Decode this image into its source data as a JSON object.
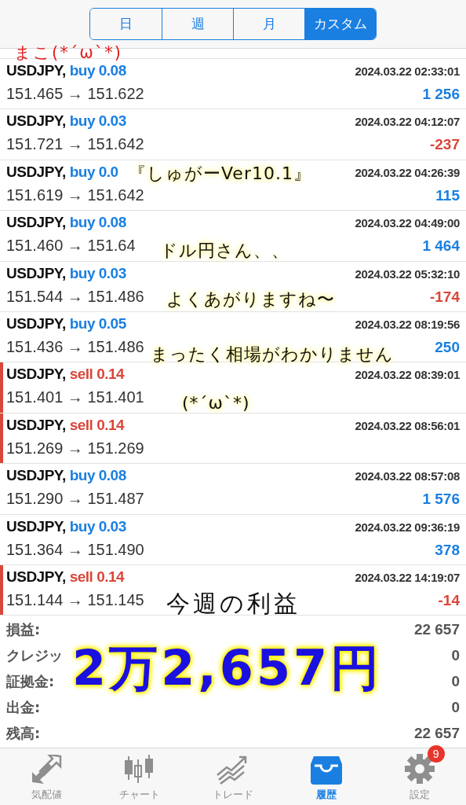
{
  "tabs": [
    {
      "label": "日",
      "selected": false
    },
    {
      "label": "週",
      "selected": false
    },
    {
      "label": "月",
      "selected": false
    },
    {
      "label": "カスタム",
      "selected": true
    }
  ],
  "trades": [
    {
      "symbol": "USDJPY,",
      "order": "buy 0.08",
      "kind": "buy",
      "prices": "151.465 → 151.622",
      "time": "2024.03.22 02:33:01",
      "profit": "1 256",
      "loss": false
    },
    {
      "symbol": "USDJPY,",
      "order": "buy 0.03",
      "kind": "buy",
      "prices": "151.721 → 151.642",
      "time": "2024.03.22 04:12:07",
      "profit": "-237",
      "loss": true
    },
    {
      "symbol": "USDJPY,",
      "order": "buy 0.0",
      "kind": "buy",
      "prices": "151.619 → 151.642",
      "time": "2024.03.22 04:26:39",
      "profit": "115",
      "loss": false
    },
    {
      "symbol": "USDJPY,",
      "order": "buy 0.08",
      "kind": "buy",
      "prices": "151.460 → 151.64",
      "time": "2024.03.22 04:49:00",
      "profit": "1 464",
      "loss": false
    },
    {
      "symbol": "USDJPY,",
      "order": "buy 0.03",
      "kind": "buy",
      "prices": "151.544 → 151.486",
      "time": "2024.03.22 05:32:10",
      "profit": "-174",
      "loss": true
    },
    {
      "symbol": "USDJPY,",
      "order": "buy 0.05",
      "kind": "buy",
      "prices": "151.436 → 151.486",
      "time": "2024.03.22 08:19:56",
      "profit": "250",
      "loss": false
    },
    {
      "symbol": "USDJPY,",
      "order": "sell 0.14",
      "kind": "sell",
      "prices": "151.401 → 151.401",
      "time": "2024.03.22 08:39:01"
    },
    {
      "symbol": "USDJPY,",
      "order": "sell 0.14",
      "kind": "sell",
      "prices": "151.269 → 151.269",
      "time": "2024.03.22 08:56:01"
    },
    {
      "symbol": "USDJPY,",
      "order": "buy 0.08",
      "kind": "buy",
      "prices": "151.290 → 151.487",
      "time": "2024.03.22 08:57:08",
      "profit": "1 576",
      "loss": false
    },
    {
      "symbol": "USDJPY,",
      "order": "buy 0.03",
      "kind": "buy",
      "prices": "151.364 → 151.490",
      "time": "2024.03.22 09:36:19",
      "profit": "378",
      "loss": false
    },
    {
      "symbol": "USDJPY,",
      "order": "sell 0.14",
      "kind": "sell",
      "prices": "151.144 → 151.145",
      "time": "2024.03.22 14:19:07",
      "profit": "-14",
      "loss": true
    }
  ],
  "summary": [
    {
      "label": "損益:",
      "value": "22 657"
    },
    {
      "label": "クレジッ",
      "value": "0"
    },
    {
      "label": "証拠金:",
      "value": "0"
    },
    {
      "label": "出金:",
      "value": "0"
    },
    {
      "label": "残高:",
      "value": "22 657"
    }
  ],
  "annotations": [
    {
      "text": "まこ(*´ω`*)",
      "kind": "signature"
    },
    {
      "text": "『しゅがーVer10.1』",
      "kind": "note"
    },
    {
      "text": "ドル円さん、、",
      "kind": "note"
    },
    {
      "text": "よくあがりますね〜",
      "kind": "note"
    },
    {
      "text": "まったく相場がわかりません",
      "kind": "note"
    },
    {
      "text": "(*´ω`*)",
      "kind": "note"
    },
    {
      "text": "今週の利益",
      "kind": "caption"
    },
    {
      "text": "2万2,657円",
      "kind": "amount"
    }
  ],
  "nav": [
    {
      "label": "気配値",
      "selected": false
    },
    {
      "label": "チャート",
      "selected": false
    },
    {
      "label": "トレード",
      "selected": false
    },
    {
      "label": "履歴",
      "selected": true
    },
    {
      "label": "設定",
      "selected": false,
      "badge": "9"
    }
  ]
}
